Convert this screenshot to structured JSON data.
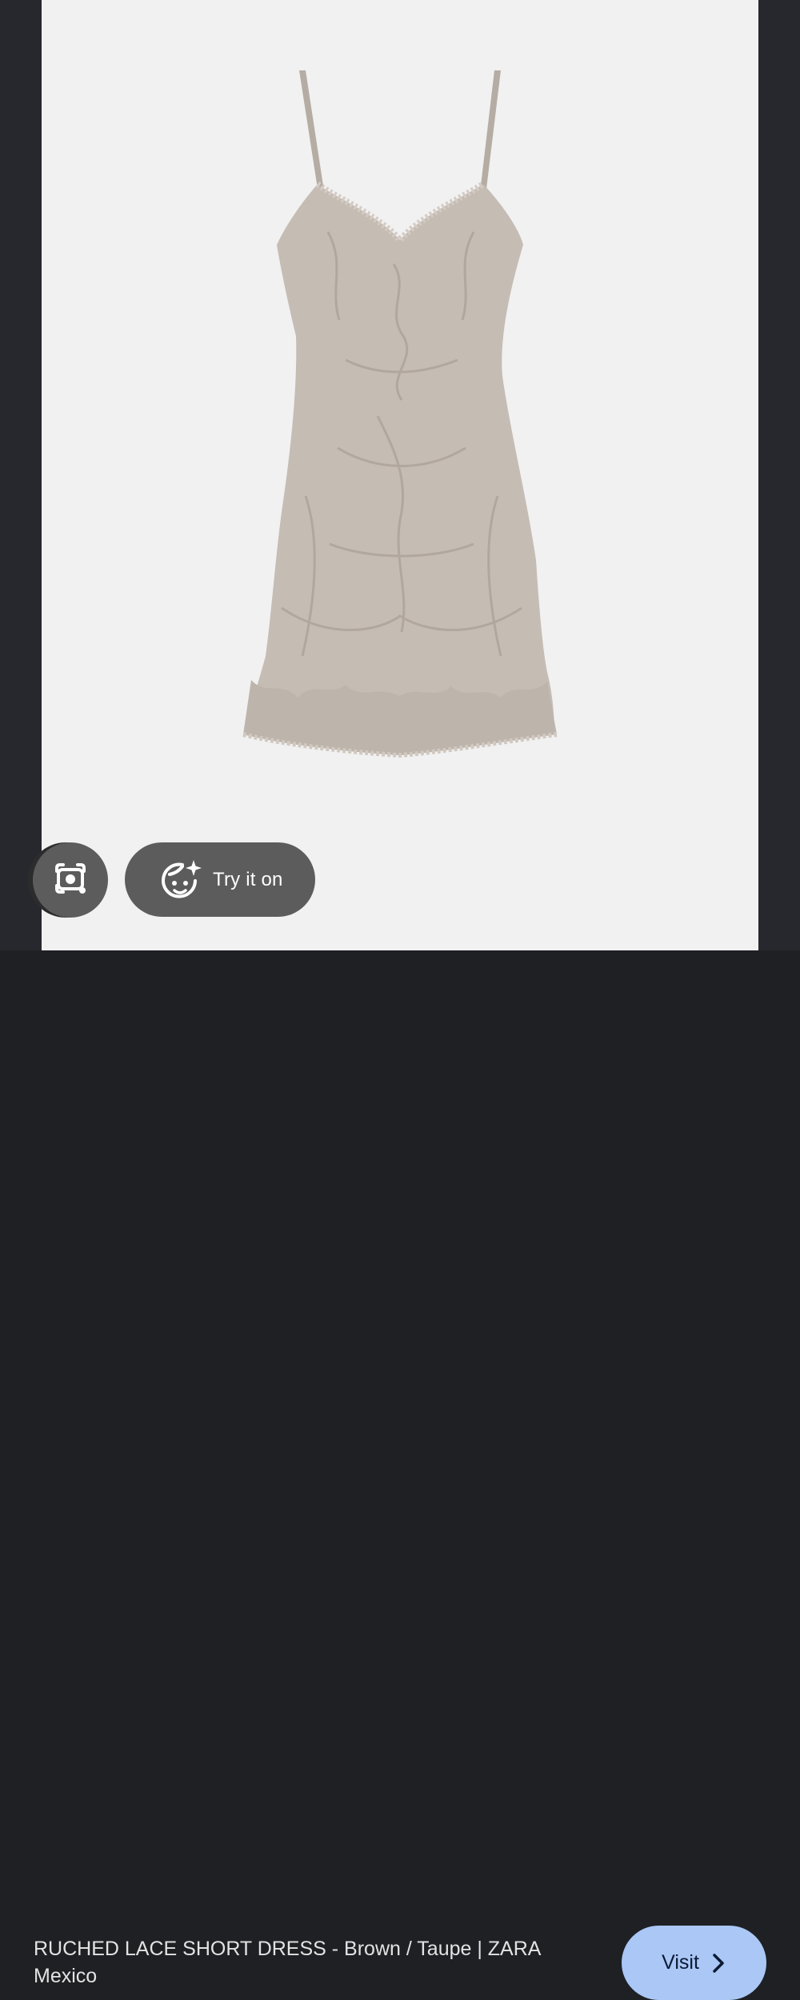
{
  "image": {
    "description_icon": "dress-product-image",
    "background_color": "#f1f1f1"
  },
  "actions": {
    "lens_icon": "lens-camera-icon",
    "try_on_label": "Try it on",
    "try_on_icon": "face-sparkle-icon"
  },
  "result": {
    "title": "RUCHED LACE SHORT DRESS - Brown / Taupe | ZARA Mexico",
    "visit_label": "Visit",
    "visit_icon": "chevron-right-icon",
    "visit_color": "#aac7f6"
  }
}
